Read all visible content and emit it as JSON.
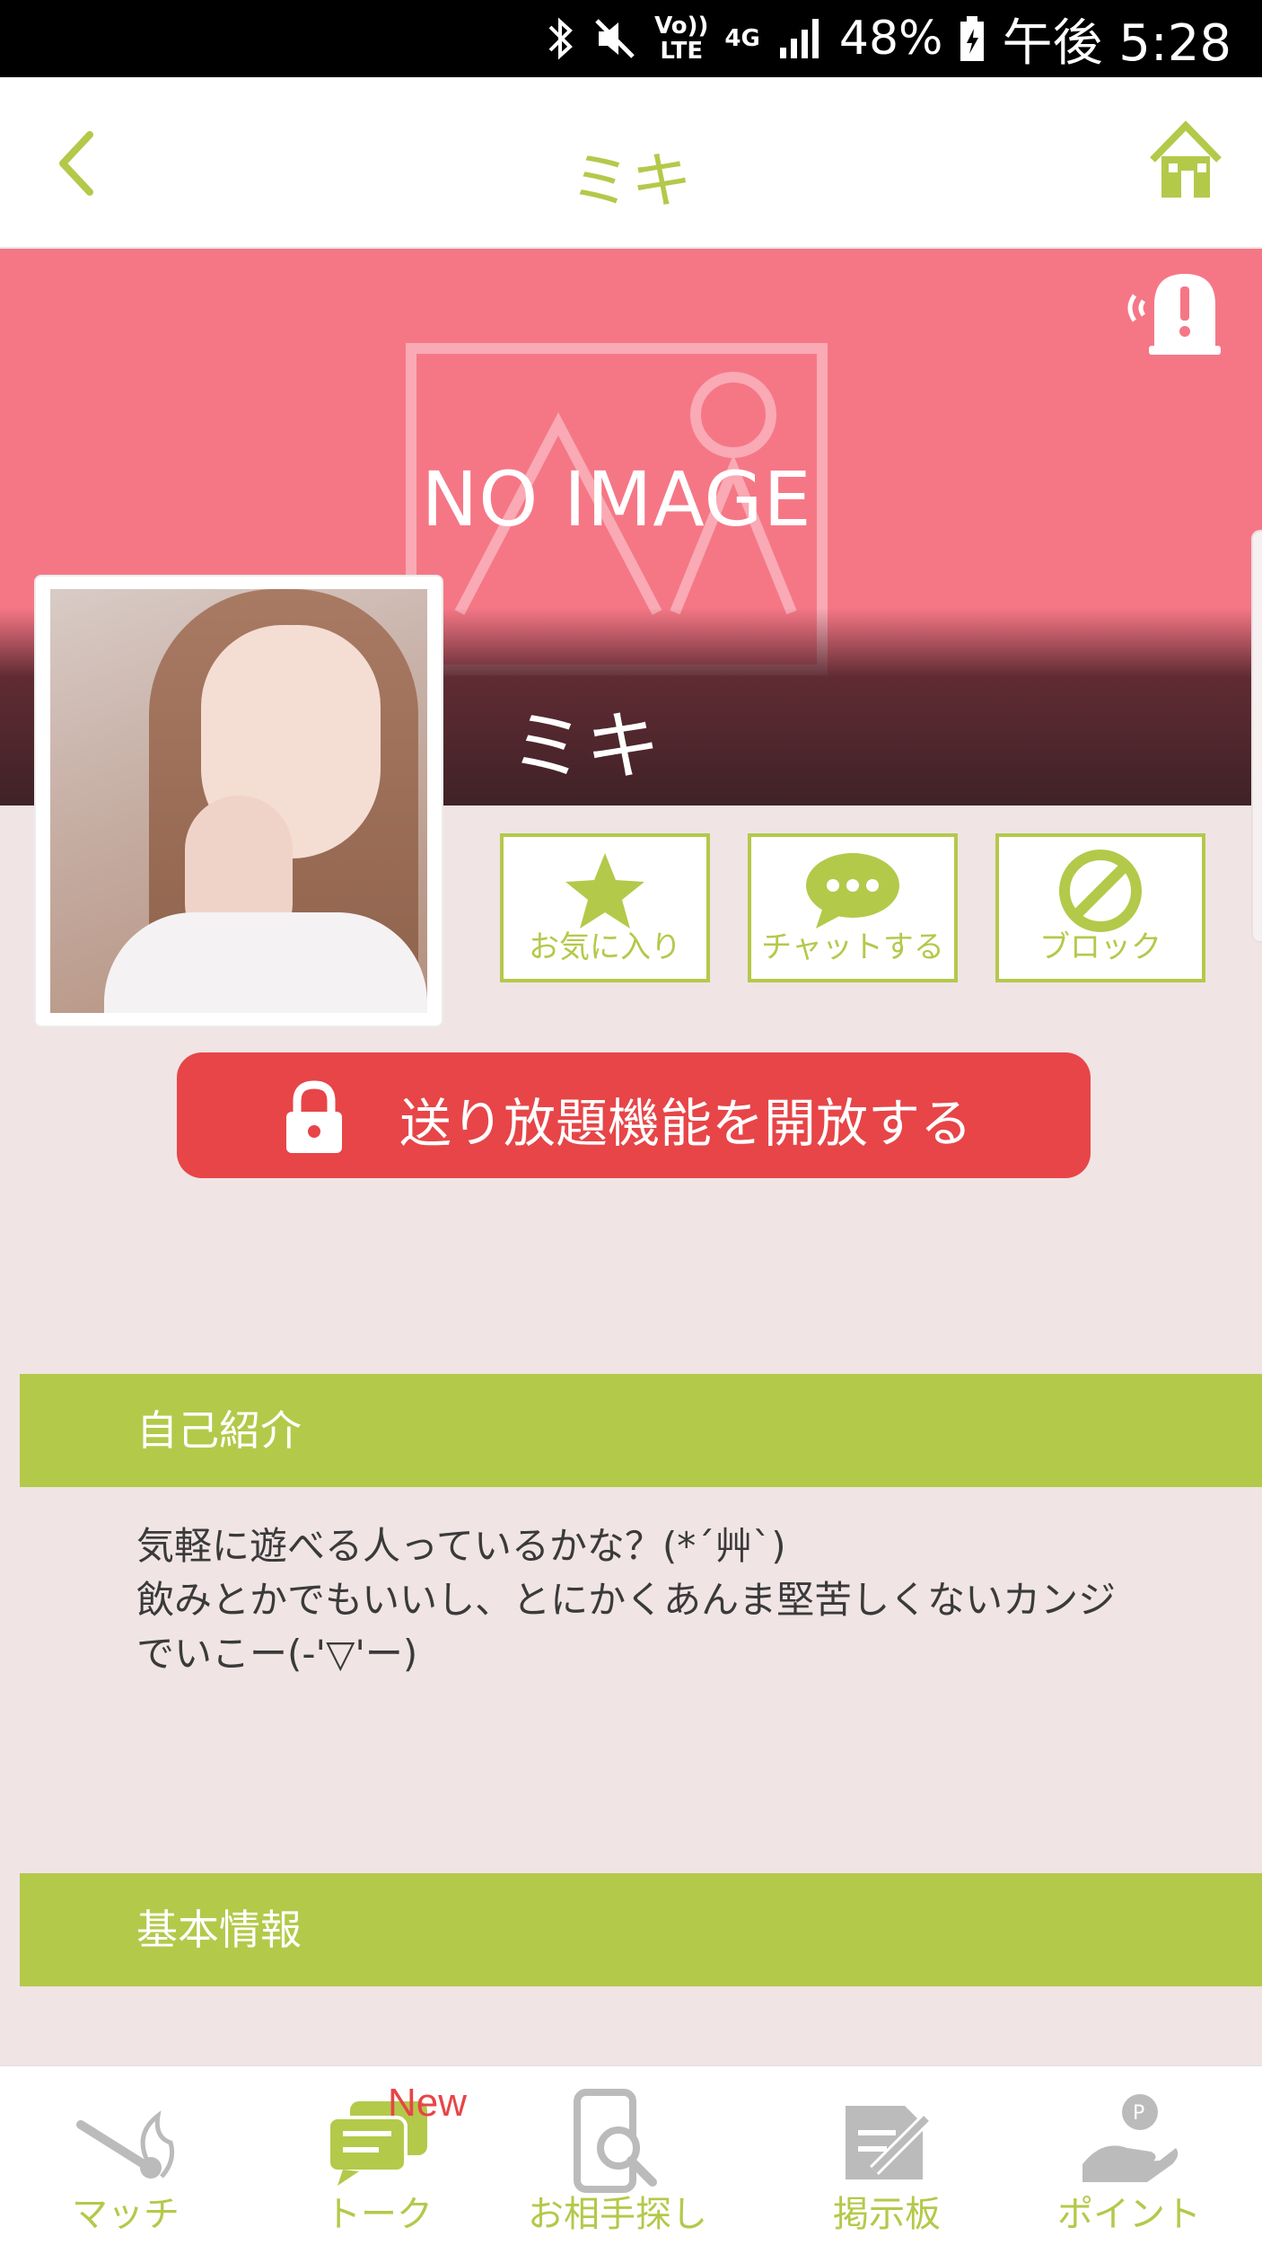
{
  "status_bar": {
    "volte_top": "Vo))",
    "volte_bottom": "LTE",
    "network": "4G",
    "battery": "48%",
    "time": "午後 5:28"
  },
  "header": {
    "title": "ミキ"
  },
  "profile": {
    "cover_placeholder": "NO IMAGE",
    "name": "ミキ"
  },
  "actions": {
    "favorite_label": "お気に入り",
    "chat_label": "チャットする",
    "block_label": "ブロック"
  },
  "unlock": {
    "label": "送り放題機能を開放する"
  },
  "self_intro": {
    "heading": "自己紹介",
    "lines": [
      "気軽に遊べる人っているかな？(*´艸`)",
      "飲みとかでもいいし、とにかくあんま堅苦しくないカンジ",
      "でいこー(-'▽'ー)"
    ]
  },
  "basic_info": {
    "heading": "基本情報"
  },
  "tabbar": {
    "match": "マッチ",
    "talk": "トーク",
    "talk_badge": "New",
    "search": "お相手探し",
    "board": "掲示板",
    "points": "ポイント"
  },
  "colors": {
    "accent": "#b3c94a",
    "cover": "#f57786",
    "cta": "#e74548",
    "background": "#f0e4e5"
  }
}
